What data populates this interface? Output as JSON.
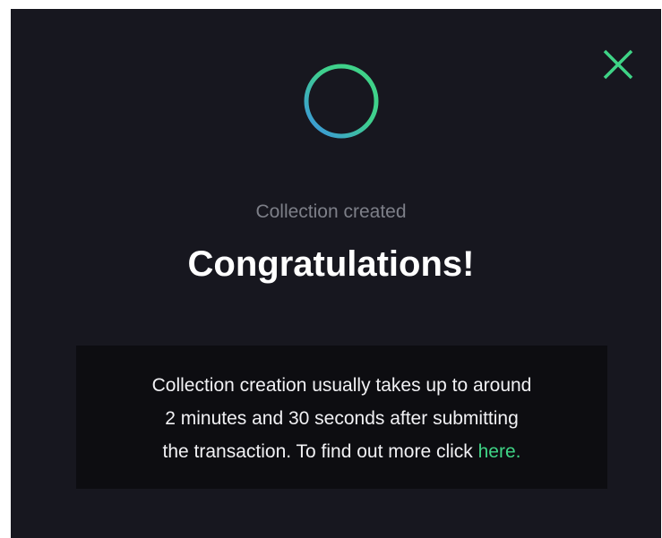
{
  "modal": {
    "subtitle": "Collection created",
    "title": "Congratulations!",
    "info": {
      "line1": "Collection creation usually takes up to around",
      "line2": "2 minutes and 30 seconds after submitting",
      "line3_prefix": "the transaction. To find out more click ",
      "link_text": "here."
    },
    "close_icon": "close-icon",
    "spinner_icon": "loading-ring-icon"
  },
  "colors": {
    "background": "#17171f",
    "info_background": "#0d0d11",
    "accent_green": "#3fd486",
    "accent_blue": "#3b8fe6",
    "subtitle": "#7d7f88",
    "title": "#ffffff"
  }
}
